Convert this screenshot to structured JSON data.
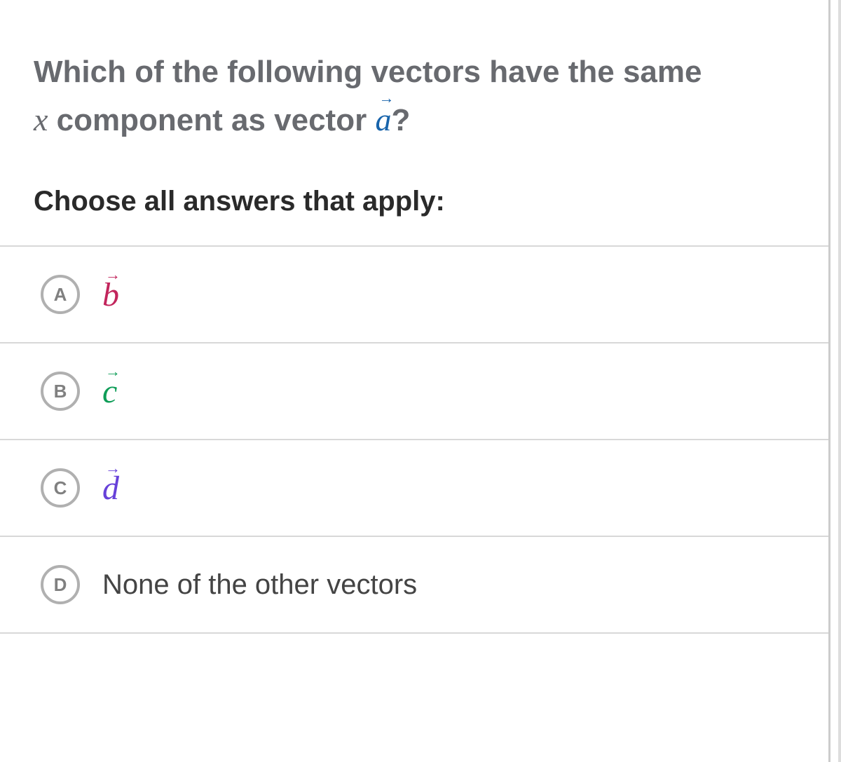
{
  "question": {
    "line1_prefix": "Which of the following vectors have the same",
    "line2_xvar": "x",
    "line2_mid": " component as vector ",
    "line2_vec_letter": "a",
    "line2_suffix": "?"
  },
  "instruction": "Choose all answers that apply:",
  "options": [
    {
      "key": "A",
      "letter": "b",
      "color_class": "col-b",
      "is_vector": true
    },
    {
      "key": "B",
      "letter": "c",
      "color_class": "col-c",
      "is_vector": true
    },
    {
      "key": "C",
      "letter": "d",
      "color_class": "col-d",
      "is_vector": true
    },
    {
      "key": "D",
      "text": "None of the other vectors",
      "is_vector": false
    }
  ],
  "arrow_glyph": "→"
}
